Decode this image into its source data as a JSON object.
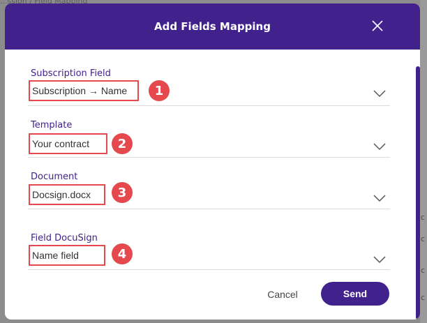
{
  "background": {
    "breadcrumb": "...ssion  /  Field Mapping",
    "edge_letters": [
      "c",
      "c",
      "c",
      "c"
    ]
  },
  "modal": {
    "title": "Add Fields Mapping",
    "close_icon": "close-icon"
  },
  "fields": [
    {
      "label": "Subscription Field",
      "value": "Subscription → Name",
      "badge": "1"
    },
    {
      "label": "Template",
      "value": "Your contract",
      "badge": "2"
    },
    {
      "label": "Document",
      "value": "Docsign.docx",
      "badge": "3"
    },
    {
      "label": "Field DocuSign",
      "value": "Name field",
      "badge": "4"
    }
  ],
  "footer": {
    "cancel_label": "Cancel",
    "send_label": "Send"
  },
  "colors": {
    "brand": "#41218c",
    "highlight": "#e5484d"
  }
}
